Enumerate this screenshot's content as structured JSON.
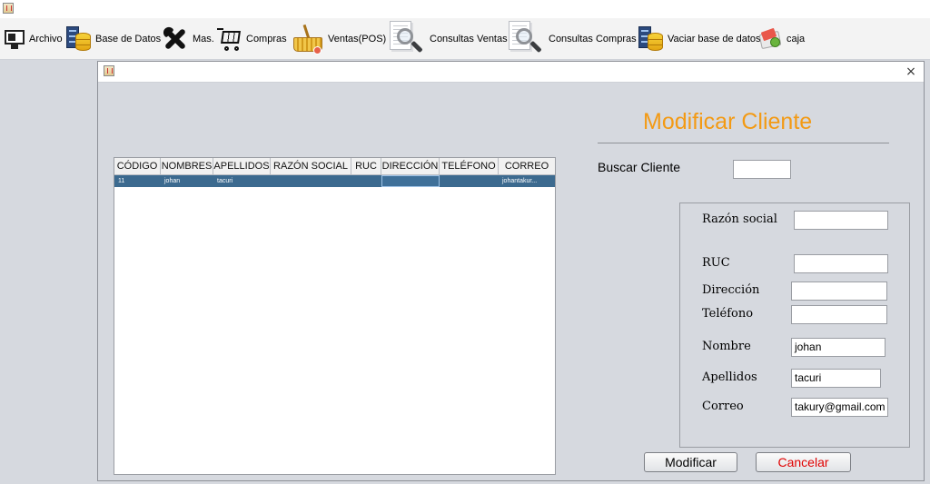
{
  "toolbar": {
    "items": [
      {
        "label": "Archivo",
        "icon": "desktop-icon"
      },
      {
        "label": "Base de Datos",
        "icon": "database-icon"
      },
      {
        "label": "Mas.",
        "icon": "tools-icon"
      },
      {
        "label": "Compras",
        "icon": "shopping-cart-icon"
      },
      {
        "label": "Ventas(POS)",
        "icon": "basket-icon"
      },
      {
        "label": "Consultas Ventas",
        "icon": "search-document-icon"
      },
      {
        "label": "Consultas Compras",
        "icon": "search-document-icon"
      },
      {
        "label": "Vaciar base de datos",
        "icon": "database-icon"
      },
      {
        "label": "caja",
        "icon": "cash-icon"
      }
    ]
  },
  "close_symbol": "×",
  "table": {
    "columns": [
      "CÓDIGO",
      "NOMBRES",
      "APELLIDOS",
      "RAZÓN SOCIAL",
      "RUC",
      "DIRECCIÓN",
      "TELÉFONO",
      "CORREO"
    ],
    "rows": [
      [
        "11",
        "johan",
        "tacuri",
        "",
        "",
        "",
        "",
        "johantakur..."
      ]
    ]
  },
  "form": {
    "title": "Modificar Cliente",
    "search_label": "Buscar  Cliente",
    "search_value": "",
    "fields": {
      "razon_social": {
        "label": "Razón social",
        "value": ""
      },
      "ruc": {
        "label": "RUC",
        "value": ""
      },
      "direccion": {
        "label": "Dirección",
        "value": ""
      },
      "telefono": {
        "label": "Teléfono",
        "value": ""
      },
      "nombre": {
        "label": "Nombre",
        "value": "johan"
      },
      "apellidos": {
        "label": "Apellidos",
        "value": "tacuri"
      },
      "correo": {
        "label": "Correo",
        "value": "takury@gmail.com"
      }
    },
    "modify_label": "Modificar",
    "cancel_label": "Cancelar"
  },
  "colors": {
    "title": "#f39a14",
    "cancel_text": "#e00000",
    "selected_row": "#3c6a8f"
  }
}
